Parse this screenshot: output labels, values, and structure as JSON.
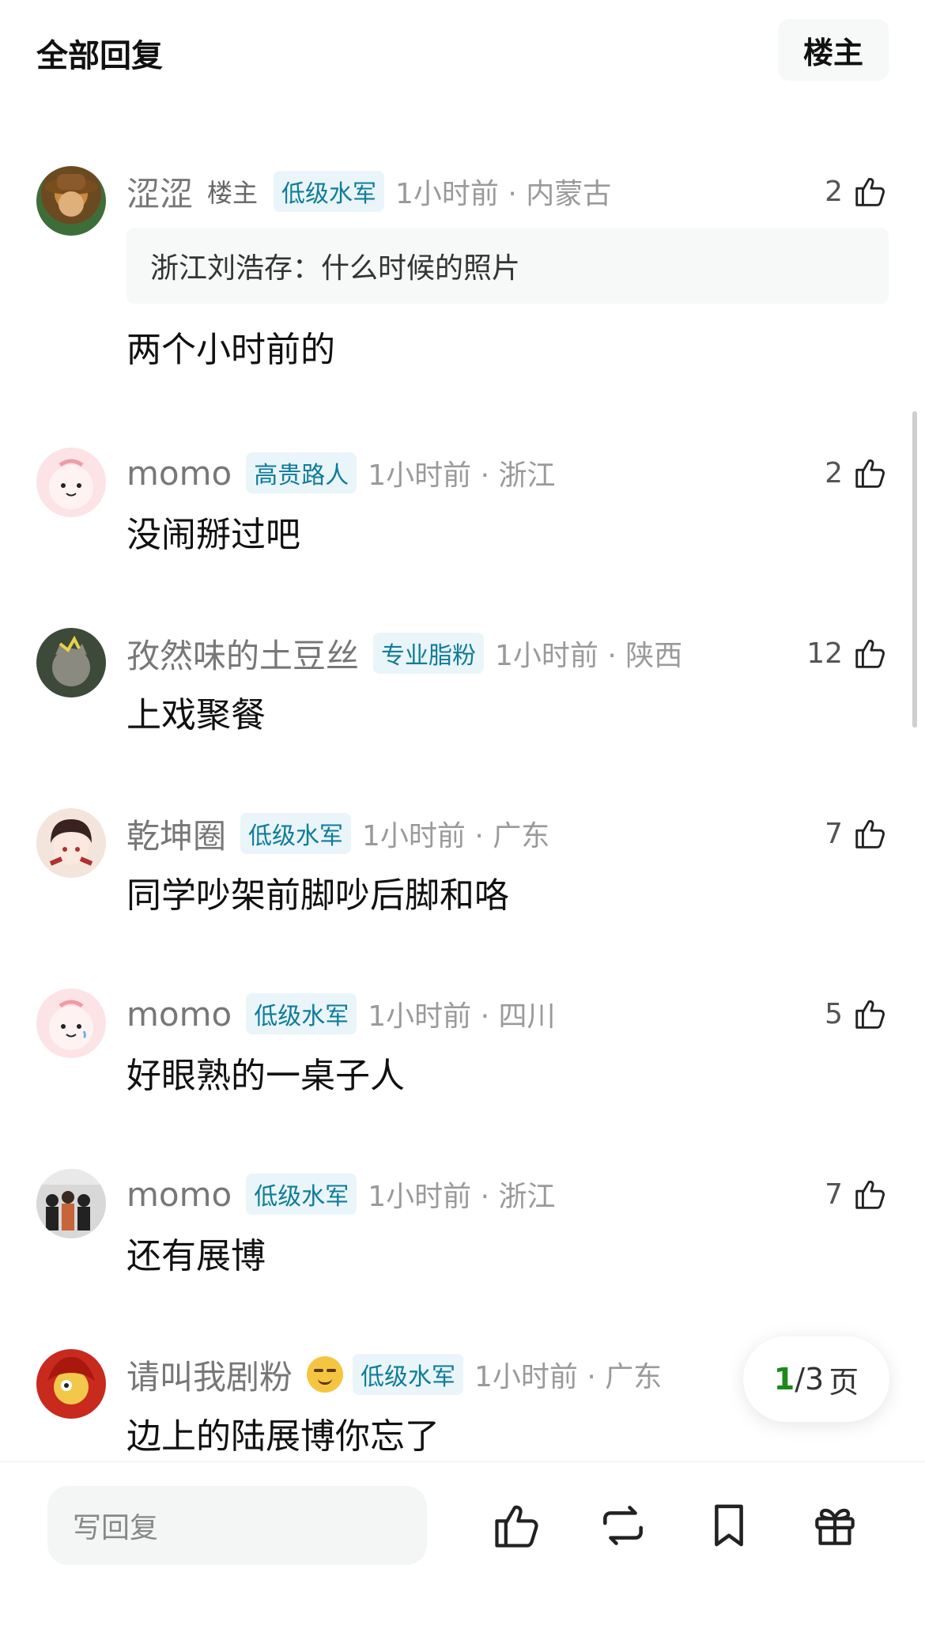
{
  "header": {
    "title": "全部回复",
    "owner_filter": "楼主"
  },
  "comments": [
    {
      "username": "涩涩",
      "owner_tag": "楼主",
      "badge": "低级水军",
      "time_location": "1小时前 · 内蒙古",
      "likes": "2",
      "quote": "浙江刘浩存：什么时候的照片",
      "content": "两个小时前的"
    },
    {
      "username": "momo",
      "badge": "高贵路人",
      "time_location": "1小时前 · 浙江",
      "likes": "2",
      "content": "没闹掰过吧"
    },
    {
      "username": "孜然味的土豆丝",
      "badge": "专业脂粉",
      "time_location": "1小时前 · 陕西",
      "likes": "12",
      "content": "上戏聚餐"
    },
    {
      "username": "乾坤圈",
      "badge": "低级水军",
      "time_location": "1小时前 · 广东",
      "likes": "7",
      "content": "同学吵架前脚吵后脚和咯"
    },
    {
      "username": "momo",
      "badge": "低级水军",
      "time_location": "1小时前 · 四川",
      "likes": "5",
      "content": "好眼熟的一桌子人"
    },
    {
      "username": "momo",
      "badge": "低级水军",
      "time_location": "1小时前 · 浙江",
      "likes": "7",
      "content": "还有展博"
    },
    {
      "username": "请叫我剧粉",
      "badge": "低级水军",
      "time_location": "1小时前 · 广东",
      "likes": "",
      "content": "边上的陆展博你忘了"
    }
  ],
  "pager": {
    "current": "1",
    "total": "/3",
    "suffix": "页"
  },
  "bottom_bar": {
    "reply_placeholder": "写回复"
  },
  "icons": [
    "thumb-up-icon",
    "repost-icon",
    "bookmark-icon",
    "gift-icon"
  ],
  "colors": {
    "badge_text": "#0e7c9a",
    "badge_bg": "#eaf5f9",
    "pager_current": "#1a8a1a"
  }
}
